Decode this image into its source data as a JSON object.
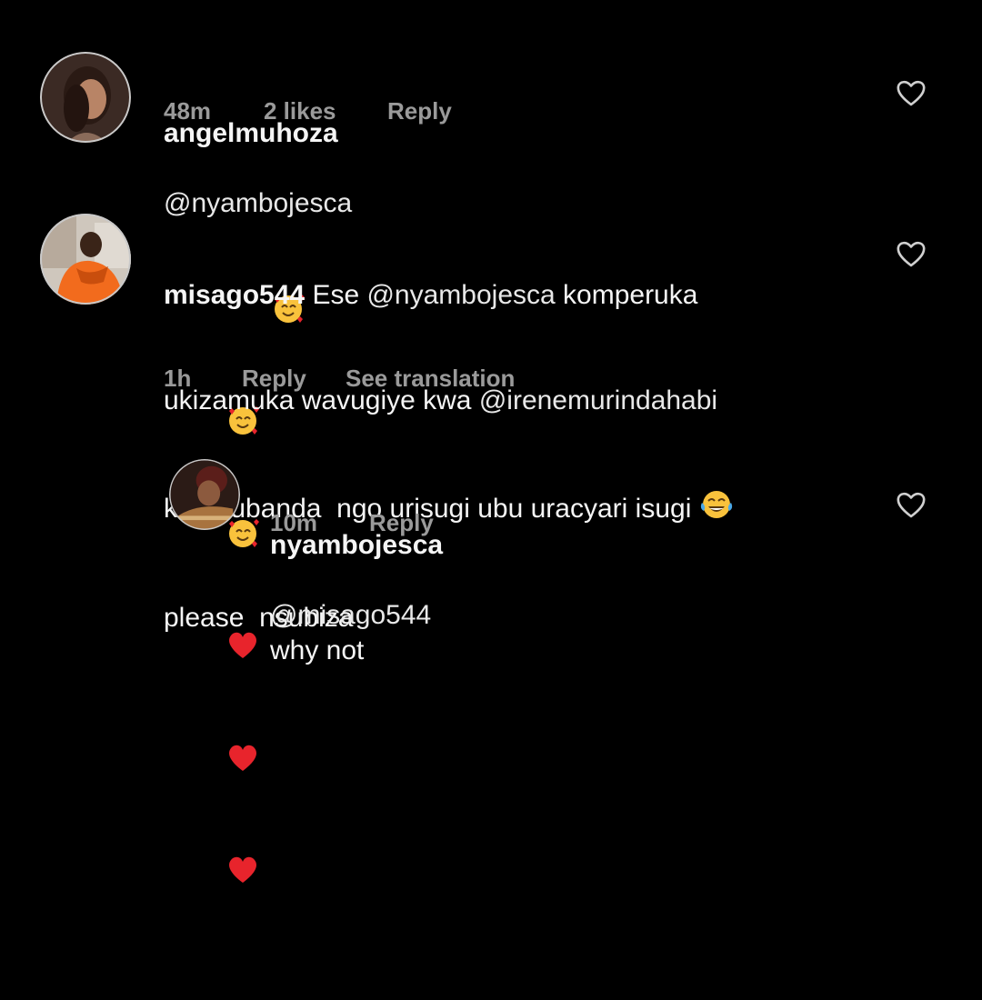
{
  "comments": [
    {
      "username": "angelmuhoza",
      "mention1": "@nyambojesca",
      "emojis": [
        "smiling-face-with-hearts",
        "smiling-face-with-hearts",
        "smiling-face-with-hearts",
        "red-heart",
        "red-heart",
        "red-heart"
      ],
      "time": "48m",
      "likes": "2 likes",
      "reply_label": "Reply"
    },
    {
      "username": "misago544",
      "text_a": "Ese ",
      "mention1": "@nyambojesca",
      "text_b": " komperuka",
      "line2_a": "ukizamuka wavugiye kwa ",
      "mention2": "@irenemurindahabi",
      "line3": "kukarubanda  ngo urisugi ubu uracyari isugi ",
      "emoji": "face-with-tears-of-joy",
      "line4": "please  nsubiza",
      "time": "1h",
      "reply_label": "Reply",
      "translate_label": "See translation"
    },
    {
      "username": "nyambojesca",
      "mention1": "@misago544",
      "text_b": " why not",
      "time": "10m",
      "reply_label": "Reply"
    }
  ],
  "colors": {
    "background": "#000000",
    "text": "#f5f5f5",
    "meta": "#9a9a9a",
    "emoji_heart": "#e8242c",
    "emoji_face": "#f9c23c"
  }
}
